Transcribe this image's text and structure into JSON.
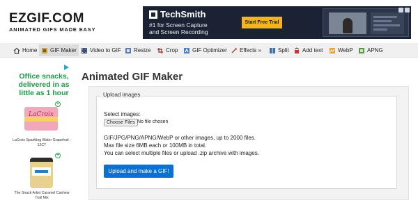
{
  "logo": {
    "name": "EZGIF.COM",
    "tagline": "ANIMATED GIFS MADE EASY"
  },
  "banner_ad": {
    "brand": "TechSmith",
    "line1": "#1 for Screen Capture",
    "line2": "and Screen Recording",
    "cta": "Start Free Trial",
    "colors": {
      "background": "#1b2233",
      "cta": "#f5b41b"
    }
  },
  "nav": {
    "items": [
      {
        "label": "Home",
        "icon": "house-icon"
      },
      {
        "label": "GIF Maker",
        "icon": "film-icon",
        "active": true
      },
      {
        "label": "Video to GIF",
        "icon": "video-icon"
      },
      {
        "label": "Resize",
        "icon": "resize-icon"
      },
      {
        "label": "Crop",
        "icon": "crop-icon"
      },
      {
        "label": "GIF Optimizer",
        "icon": "optimize-icon"
      },
      {
        "label": "Effects »",
        "icon": "effects-icon"
      },
      {
        "label": "Split",
        "icon": "split-icon"
      },
      {
        "label": "Add text",
        "icon": "text-icon"
      },
      {
        "label": "WebP",
        "icon": "webp-icon"
      },
      {
        "label": "APNG",
        "icon": "apng-icon"
      }
    ]
  },
  "side_ad": {
    "headline": "Office snacks, delivered in as little as 1 hour",
    "product1": {
      "caption": "LaCroix Sparkling Water Grapefruit - 12CT",
      "image_text": "LaCroix"
    },
    "product2": {
      "caption": "The Snack Artist Caramel Cashew Trail Mix"
    },
    "accent_color": "#1f9a45"
  },
  "main": {
    "title": "Animated GIF Maker",
    "legend": "Upload images",
    "select_label": "Select images:",
    "file_button": "Choose Files",
    "file_status": "No file chosen",
    "info_lines": [
      "GIF/JPG/PNG/APNG/WebP or other images, up to 2000 files.",
      "Max file size 6MB each or 100MB in total.",
      "You can select multiple files or upload .zip archive with images."
    ],
    "submit_label": "Upload and make a GIF!",
    "submit_color": "#0c6fd3"
  }
}
